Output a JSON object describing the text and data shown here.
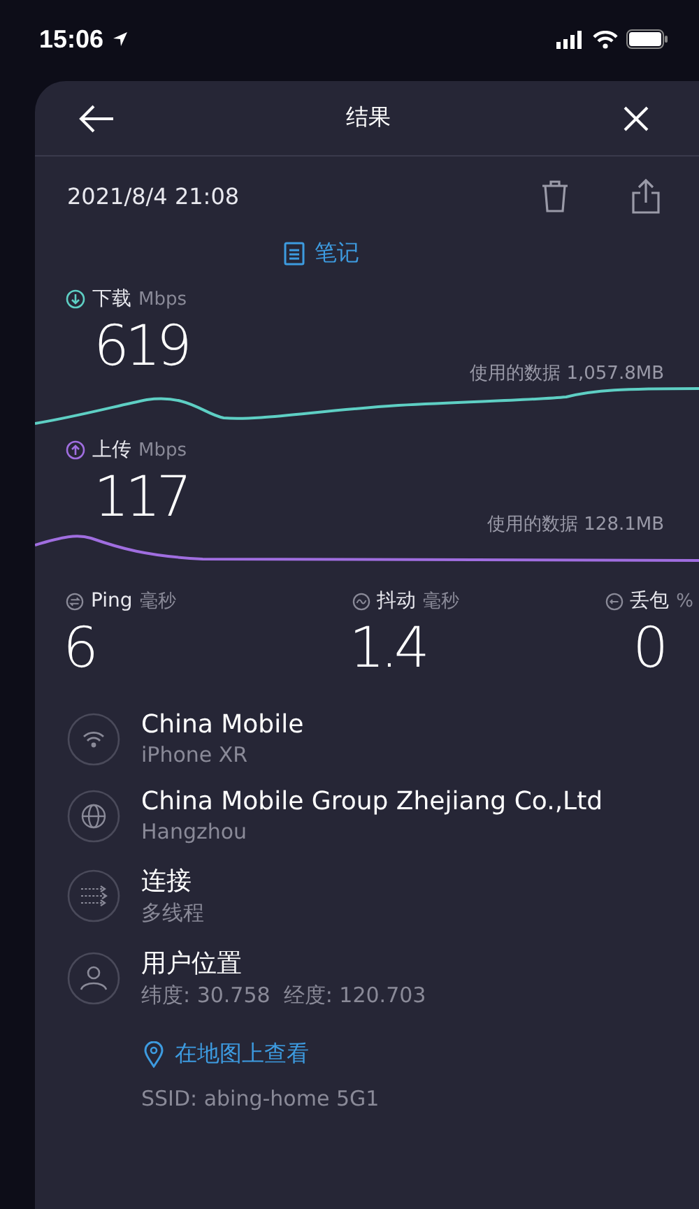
{
  "status_bar": {
    "time": "15:06"
  },
  "header": {
    "title": "结果"
  },
  "result": {
    "datetime": "2021/8/4 21:08",
    "notes_link": "笔记"
  },
  "speeds": [
    {
      "kind": "download",
      "label": "下载",
      "unit": "Mbps",
      "value": "619",
      "data_used": "使用的数据 1,057.8MB",
      "color": "#5ecfc4"
    },
    {
      "kind": "upload",
      "label": "上传",
      "unit": "Mbps",
      "value": "117",
      "data_used": "使用的数据 128.1MB",
      "color": "#a06ee0"
    }
  ],
  "stats": [
    {
      "kind": "ping",
      "label": "Ping",
      "unit": "毫秒",
      "value": "6"
    },
    {
      "kind": "jitter",
      "label": "抖动",
      "unit": "毫秒",
      "value": "1.4"
    },
    {
      "kind": "loss",
      "label": "丢包",
      "unit": "%",
      "value": "0"
    }
  ],
  "details": [
    {
      "kind": "wifi",
      "title": "China Mobile",
      "subtitle": "iPhone XR"
    },
    {
      "kind": "globe",
      "title": "China Mobile Group Zhejiang Co.,Ltd",
      "subtitle": "Hangzhou"
    },
    {
      "kind": "connections",
      "title": "连接",
      "subtitle": "多线程"
    },
    {
      "kind": "user",
      "title": "用户位置",
      "subtitle": "纬度: 30.758  经度: 120.703"
    }
  ],
  "map_link": "在地图上查看",
  "ssid": "SSID: abing-home 5G1"
}
